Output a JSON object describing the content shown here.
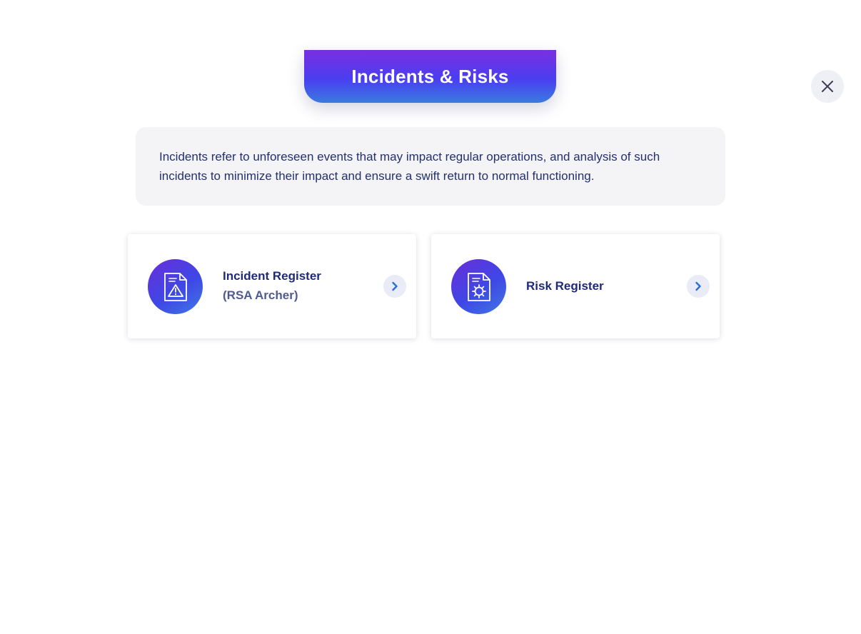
{
  "header": {
    "title": "Incidents & Risks"
  },
  "description": "Incidents refer to unforeseen events  that may impact regular operations, and analysis of such incidents to minimize their impact and ensure a swift return to normal functioning.",
  "cards": [
    {
      "title": "Incident Register",
      "subtitle": "(RSA Archer)",
      "icon": "document-warning-icon"
    },
    {
      "title": "Risk Register",
      "subtitle": "",
      "icon": "document-gear-icon"
    }
  ],
  "colors": {
    "accent_primary": "#4a3ef0",
    "accent_purple": "#7a2fe0",
    "text_navy": "#1f2a78",
    "panel_bg": "#f4f4f6"
  }
}
